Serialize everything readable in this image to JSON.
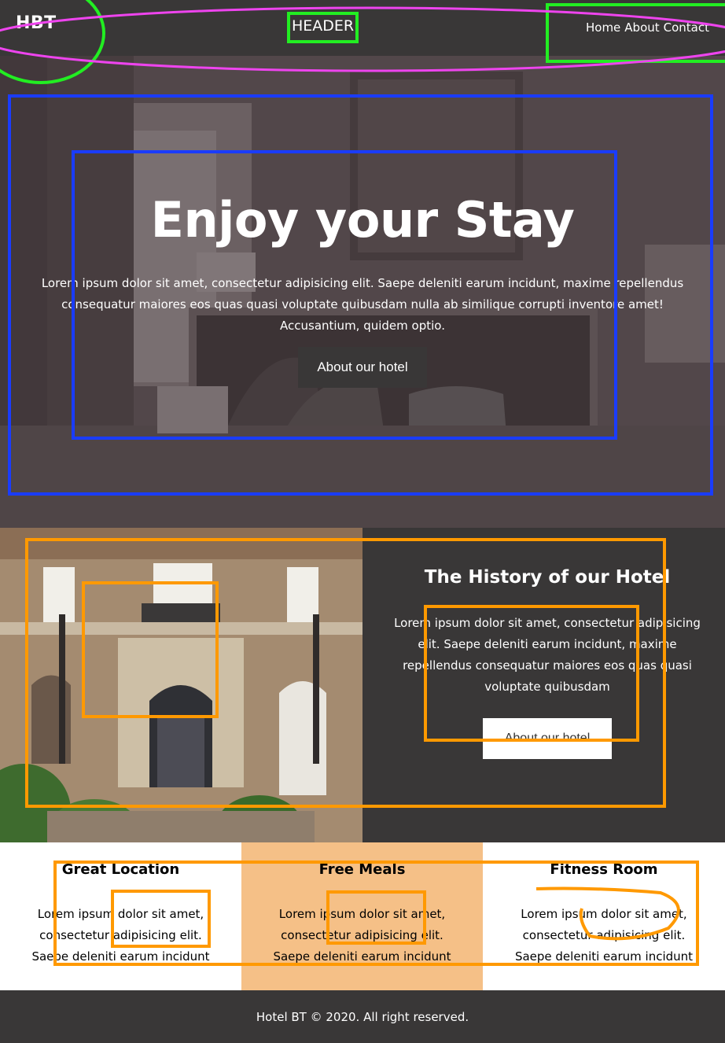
{
  "header": {
    "brand": "HBT",
    "label": "HEADER",
    "nav": [
      "Home",
      "About",
      "Contact"
    ]
  },
  "hero": {
    "title": "Enjoy your Stay",
    "text": "Lorem ipsum dolor sit amet, consectetur adipisicing elit. Saepe deleniti earum incidunt, maxime repellendus consequatur maiores eos quas quasi voluptate quibusdam nulla ab similique corrupti inventore amet! Accusantium, quidem optio.",
    "button": "About our hotel"
  },
  "history": {
    "title": "The History of our Hotel",
    "text": "Lorem ipsum dolor sit amet, consectetur adipisicing elit. Saepe deleniti earum incidunt, maxime repellendus consequatur maiores eos quas quasi voluptate quibusdam",
    "button": "About our hotel"
  },
  "features": [
    {
      "title": "Great Location",
      "text": "Lorem ipsum dolor sit amet, consectetur adipisicing elit. Saepe deleniti earum incidunt"
    },
    {
      "title": "Free Meals",
      "text": "Lorem ipsum dolor sit amet, consectetur adipisicing elit. Saepe deleniti earum incidunt"
    },
    {
      "title": "Fitness Room",
      "text": "Lorem ipsum dolor sit amet, consectetur adipisicing elit. Saepe deleniti earum incidunt"
    }
  ],
  "footer": {
    "text": "Hotel BT © 2020. All right reserved."
  },
  "colors": {
    "dark": "#393737",
    "accent_peach": "#f5c087",
    "annotation_green": "#22ee22",
    "annotation_magenta": "#ee44ee",
    "annotation_blue": "#1a3cff",
    "annotation_orange": "#ff9900"
  }
}
